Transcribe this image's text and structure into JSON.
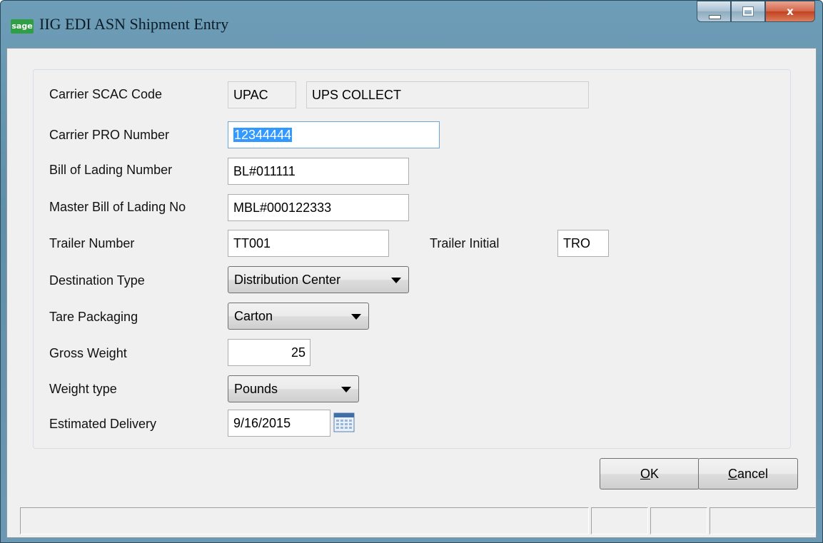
{
  "window": {
    "logo_text": "sage",
    "title": "IIG EDI ASN Shipment Entry",
    "controls": {
      "minimize": "minimize",
      "maximize": "maximize",
      "close": "x"
    }
  },
  "form": {
    "carrier_scac_code": {
      "label": "Carrier SCAC Code",
      "code": "UPAC",
      "description": "UPS COLLECT"
    },
    "carrier_pro_number": {
      "label": "Carrier PRO Number",
      "value": "12344444"
    },
    "bill_of_lading_number": {
      "label": "Bill of Lading Number",
      "value": "BL#011111"
    },
    "master_bill_of_lading_no": {
      "label": "Master Bill of Lading No",
      "value": "MBL#000122333"
    },
    "trailer_number": {
      "label": "Trailer Number",
      "value": "TT001"
    },
    "trailer_initial": {
      "label": "Trailer Initial",
      "value": "TRO"
    },
    "destination_type": {
      "label": "Destination Type",
      "value": "Distribution Center"
    },
    "tare_packaging": {
      "label": "Tare Packaging",
      "value": "Carton"
    },
    "gross_weight": {
      "label": "Gross Weight",
      "value": "25"
    },
    "weight_type": {
      "label": "Weight type",
      "value": "Pounds"
    },
    "estimated_delivery": {
      "label": "Estimated Delivery",
      "value": "9/16/2015",
      "icon": "calendar-icon"
    }
  },
  "buttons": {
    "ok": {
      "mnemonic": "O",
      "rest": "K"
    },
    "cancel": {
      "mnemonic": "C",
      "rest": "ancel"
    }
  },
  "colors": {
    "selection": "#3399ff",
    "title_bar": "#6e9db8",
    "close_button": "#c2411f",
    "logo": "#2f9e44"
  }
}
